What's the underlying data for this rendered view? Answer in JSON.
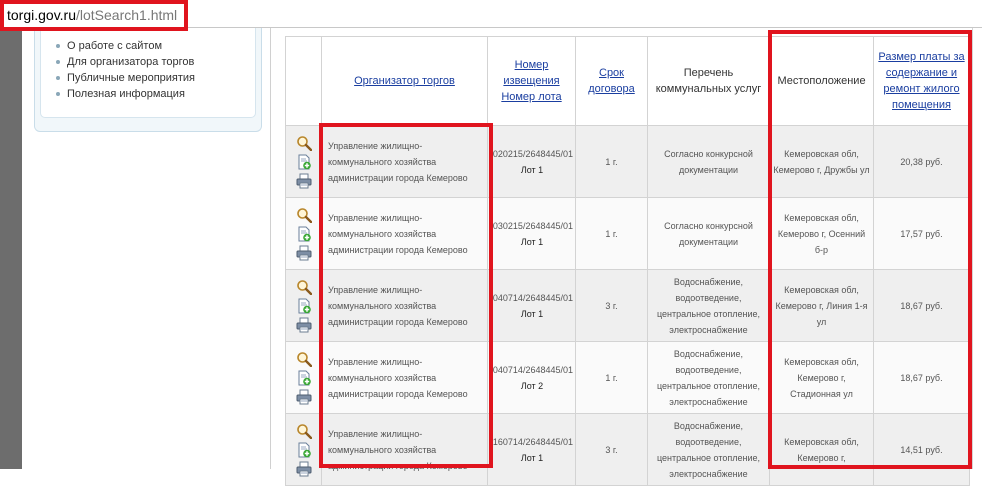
{
  "address_bar": {
    "host": "torgi.gov.ru",
    "path": "/lotSearch1.html"
  },
  "sidebar": {
    "items": [
      {
        "label": "О работе с сайтом"
      },
      {
        "label": "Для организатора торгов"
      },
      {
        "label": "Публичные мероприятия"
      },
      {
        "label": "Полезная информация"
      }
    ]
  },
  "table": {
    "headers": {
      "organizer": "Организатор торгов",
      "notice_line1": "Номер извещения",
      "notice_line2": "Номер лота",
      "term": "Срок договора",
      "services": "Перечень коммунальных услуг",
      "location": "Местоположение",
      "fee": "Размер платы за содержание и ремонт жилого помещения"
    },
    "rows": [
      {
        "organizer": "Управление жилищно-коммунального хозяйства администрации города Кемерово",
        "notice": "020215/2648445/01",
        "lot": "Лот 1",
        "term": "1 г.",
        "services": "Согласно конкурсной документации",
        "location": "Кемеровская обл, Кемерово г, Дружбы ул",
        "fee": "20,38 руб."
      },
      {
        "organizer": "Управление жилищно-коммунального хозяйства администрации города Кемерово",
        "notice": "030215/2648445/01",
        "lot": "Лот 1",
        "term": "1 г.",
        "services": "Согласно конкурсной документации",
        "location": "Кемеровская обл, Кемерово г, Осенний б-р",
        "fee": "17,57 руб."
      },
      {
        "organizer": "Управление жилищно-коммунального хозяйства администрации города Кемерово",
        "notice": "040714/2648445/01",
        "lot": "Лот 1",
        "term": "3 г.",
        "services": "Водоснабжение, водоотведение, центральное отопление, электроснабжение",
        "location": "Кемеровская обл, Кемерово г, Линия 1-я ул",
        "fee": "18,67 руб."
      },
      {
        "organizer": "Управление жилищно-коммунального хозяйства администрации города Кемерово",
        "notice": "040714/2648445/01",
        "lot": "Лот 2",
        "term": "1 г.",
        "services": "Водоснабжение, водоотведение, центральное отопление, электроснабжение",
        "location": "Кемеровская обл, Кемерово г, Стадионная ул",
        "fee": "18,67 руб."
      },
      {
        "organizer": "Управление жилищно-коммунального хозяйства администрации города Кемерово",
        "notice": "160714/2648445/01",
        "lot": "Лот 1",
        "term": "3 г.",
        "services": "Водоснабжение, водоотведение, центральное отопление, электроснабжение",
        "location": "Кемеровская обл, Кемерово г,",
        "fee": "14,51 руб."
      }
    ]
  },
  "colors": {
    "highlight": "#e0141e",
    "link": "#1a3ea0"
  },
  "icons": [
    "magnifier-icon",
    "add-document-icon",
    "printer-icon"
  ]
}
